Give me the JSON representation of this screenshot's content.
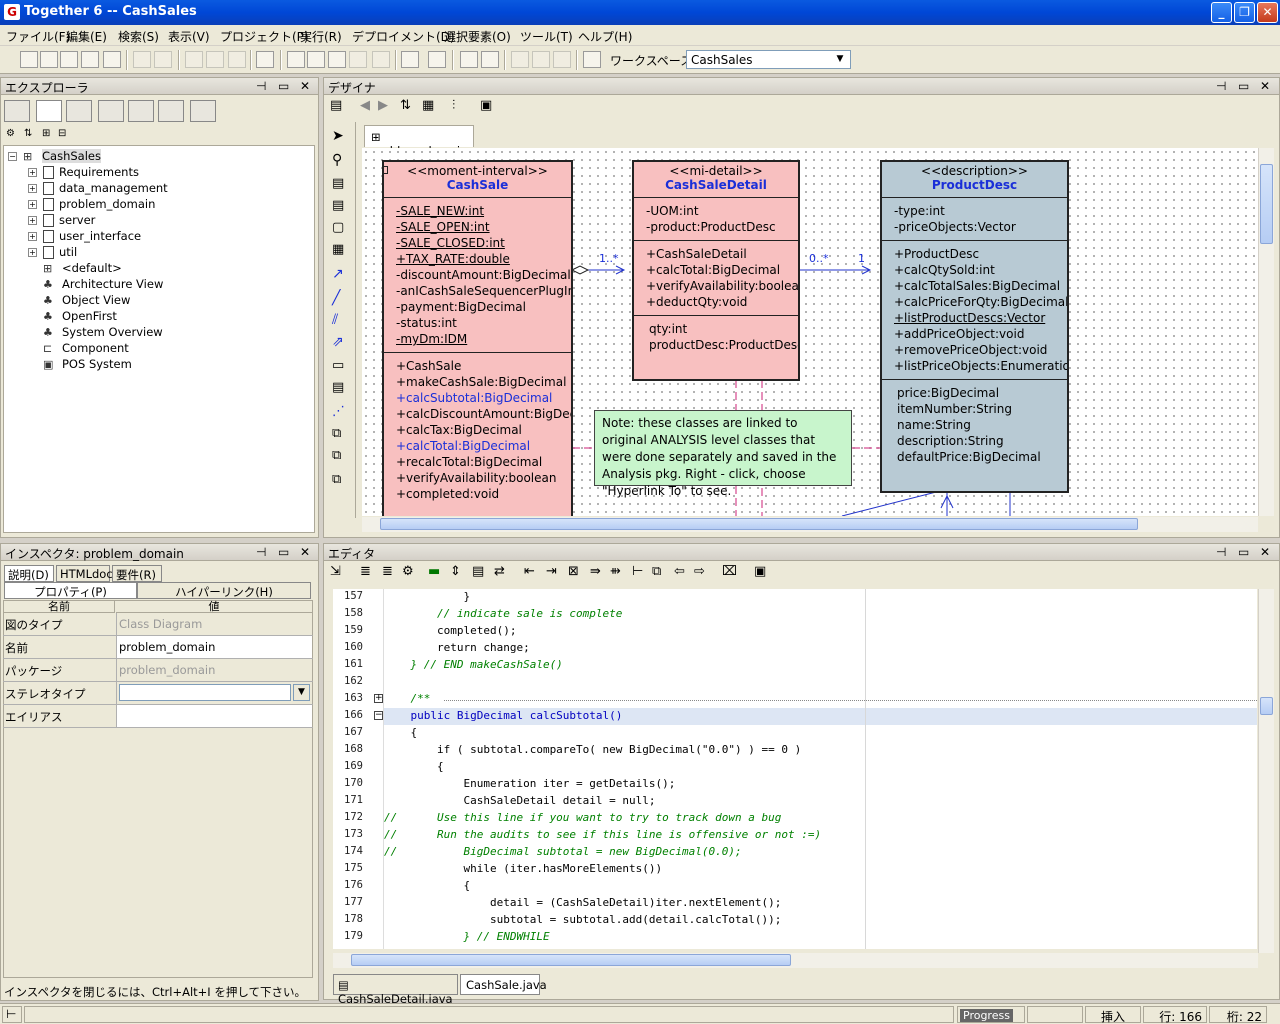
{
  "window": {
    "title": "Together 6 -- CashSales"
  },
  "menu": [
    "ファイル(F)",
    "編集(E)",
    "検索(S)",
    "表示(V)",
    "プロジェクト(P)",
    "実行(R)",
    "デプロイメント(D)",
    "選択要素(O)",
    "ツール(T)",
    "ヘルプ(H)"
  ],
  "toolbar": {
    "workspace_label": "ワークスペース:",
    "workspace_value": "CashSales"
  },
  "explorer": {
    "title": "エクスプローラ",
    "root": "CashSales",
    "items": [
      "Requirements",
      "data_management",
      "problem_domain",
      "server",
      "user_interface",
      "util",
      "<default>",
      "Architecture View",
      "Object View",
      "OpenFirst",
      "System Overview",
      "Component",
      "POS System"
    ]
  },
  "designer": {
    "title": "デザイナ",
    "tab": "problem_domain",
    "classes": {
      "cashsale": {
        "stereotype": "<<moment-interval>>",
        "name": "CashSale",
        "attrs": [
          "-SALE_NEW:int",
          "-SALE_OPEN:int",
          "-SALE_CLOSED:int",
          "+TAX_RATE:double",
          "-discountAmount:BigDecimal",
          "-anICashSaleSequencerPlugInF",
          "-payment:BigDecimal",
          "-status:int",
          "-myDm:IDM"
        ],
        "ops": [
          "+CashSale",
          "+makeCashSale:BigDecimal",
          "+calcSubtotal:BigDecimal",
          "+calcDiscountAmount:BigDecim",
          "+calcTax:BigDecimal",
          "+calcTotal:BigDecimal",
          "+recalcTotal:BigDecimal",
          "+verifyAvailability:boolean",
          "+completed:void"
        ]
      },
      "detail": {
        "stereotype": "<<mi-detail>>",
        "name": "CashSaleDetail",
        "attrs": [
          "-UOM:int",
          "-product:ProductDesc"
        ],
        "ops": [
          "+CashSaleDetail",
          "+calcTotal:BigDecimal",
          "+verifyAvailability:boolean",
          "+deductQty:void"
        ],
        "props": [
          "qty:int",
          "productDesc:ProductDesc"
        ]
      },
      "product": {
        "stereotype": "<<description>>",
        "name": "ProductDesc",
        "attrs": [
          "-type:int",
          "-priceObjects:Vector"
        ],
        "ops": [
          "+ProductDesc",
          "+calcQtySold:int",
          "+calcTotalSales:BigDecimal",
          "+calcPriceForQty:BigDecimal",
          "+listProductDescs:Vector",
          "+addPriceObject:void",
          "+removePriceObject:void",
          "+listPriceObjects:Enumeration"
        ],
        "props": [
          "price:BigDecimal",
          "itemNumber:String",
          "name:String",
          "description:String",
          "defaultPrice:BigDecimal"
        ]
      }
    },
    "assoc": {
      "m1": "1..*",
      "m2": "0..*",
      "m3": "1"
    },
    "note": "Note: these classes are linked to original ANALYSIS level classes that were done separately and saved in the Analysis pkg. Right - click, choose \"Hyperlink To\" to see."
  },
  "inspector": {
    "title": "インスペクタ: problem_domain",
    "tabs": [
      "説明(D)",
      "HTMLdoc",
      "要件(R)"
    ],
    "subtabs": [
      "プロパティ(P)",
      "ハイパーリンク(H)"
    ],
    "col_name": "名前",
    "col_value": "値",
    "rows": [
      {
        "k": "図のタイプ",
        "v": "Class Diagram"
      },
      {
        "k": "名前",
        "v": "problem_domain"
      },
      {
        "k": "パッケージ",
        "v": "problem_domain"
      },
      {
        "k": "ステレオタイプ",
        "v": ""
      },
      {
        "k": "エイリアス",
        "v": ""
      }
    ],
    "hint": "インスペクタを閉じるには、Ctrl+Alt+I を押して下さい。"
  },
  "editor": {
    "title": "エディタ",
    "lines": [
      {
        "n": "157",
        "t": "            }"
      },
      {
        "n": "158",
        "t": "        // indicate sale is complete"
      },
      {
        "n": "159",
        "t": "        completed();"
      },
      {
        "n": "160",
        "t": "        return change;"
      },
      {
        "n": "161",
        "t": "    } // END makeCashSale()"
      },
      {
        "n": "162",
        "t": ""
      },
      {
        "n": "163",
        "t": "    /**"
      },
      {
        "n": "166",
        "t": "    public BigDecimal calcSubtotal()"
      },
      {
        "n": "167",
        "t": "    {"
      },
      {
        "n": "168",
        "t": "        if ( subtotal.compareTo( new BigDecimal(\"0.0\") ) == 0 )"
      },
      {
        "n": "169",
        "t": "        {"
      },
      {
        "n": "170",
        "t": "            Enumeration iter = getDetails();"
      },
      {
        "n": "171",
        "t": "            CashSaleDetail detail = null;"
      },
      {
        "n": "172",
        "t": "//      Use this line if you want to try to track down a bug"
      },
      {
        "n": "173",
        "t": "//      Run the audits to see if this line is offensive or not :=)"
      },
      {
        "n": "174",
        "t": "//          BigDecimal subtotal = new BigDecimal(0.0);"
      },
      {
        "n": "175",
        "t": "            while (iter.hasMoreElements())"
      },
      {
        "n": "176",
        "t": "            {"
      },
      {
        "n": "177",
        "t": "                detail = (CashSaleDetail)iter.nextElement();"
      },
      {
        "n": "178",
        "t": "                subtotal = subtotal.add(detail.calcTotal());"
      },
      {
        "n": "179",
        "t": "            } // ENDWHILE"
      }
    ],
    "file_tabs": [
      "CashSaleDetail.java",
      "CashSale.java"
    ]
  },
  "status": {
    "progress": "Progress",
    "mode": "挿入",
    "line": "行: 166",
    "col": "桁: 22"
  }
}
